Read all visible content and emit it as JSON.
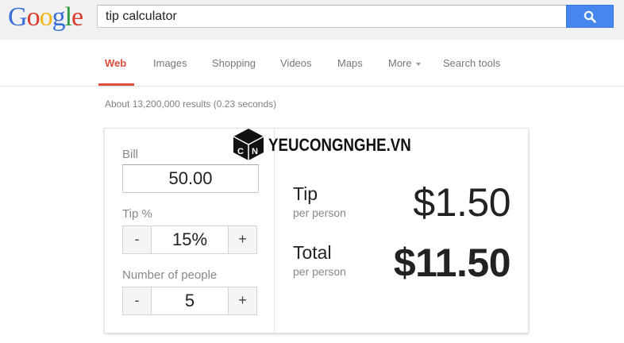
{
  "header": {
    "logo_letters": [
      "G",
      "o",
      "o",
      "g",
      "l",
      "e"
    ],
    "search_query": "tip calculator",
    "search_button_icon": "search-icon",
    "search_button_color": "#4787ed"
  },
  "nav": {
    "tabs": [
      {
        "label": "Web",
        "active": true
      },
      {
        "label": "Images",
        "active": false
      },
      {
        "label": "Shopping",
        "active": false
      },
      {
        "label": "Videos",
        "active": false
      },
      {
        "label": "Maps",
        "active": false
      },
      {
        "label": "More",
        "active": false
      },
      {
        "label": "Search tools",
        "active": false
      }
    ],
    "active_color": "#dd4b39"
  },
  "result_stats": "About 13,200,000 results (0.23 seconds)",
  "calculator": {
    "bill_label": "Bill",
    "bill_value": "50.00",
    "tip_label": "Tip %",
    "tip_value": "15%",
    "people_label": "Number of people",
    "people_value": "5",
    "minus_label": "-",
    "plus_label": "+",
    "tip_result_label": "Tip",
    "tip_result_sub": "per person",
    "tip_result_value": "$1.50",
    "total_result_label": "Total",
    "total_result_sub": "per person",
    "total_result_value": "$11.50"
  },
  "watermark": {
    "text": "YEUCONGNGHE.VN",
    "icon": "cube-logo-icon"
  }
}
